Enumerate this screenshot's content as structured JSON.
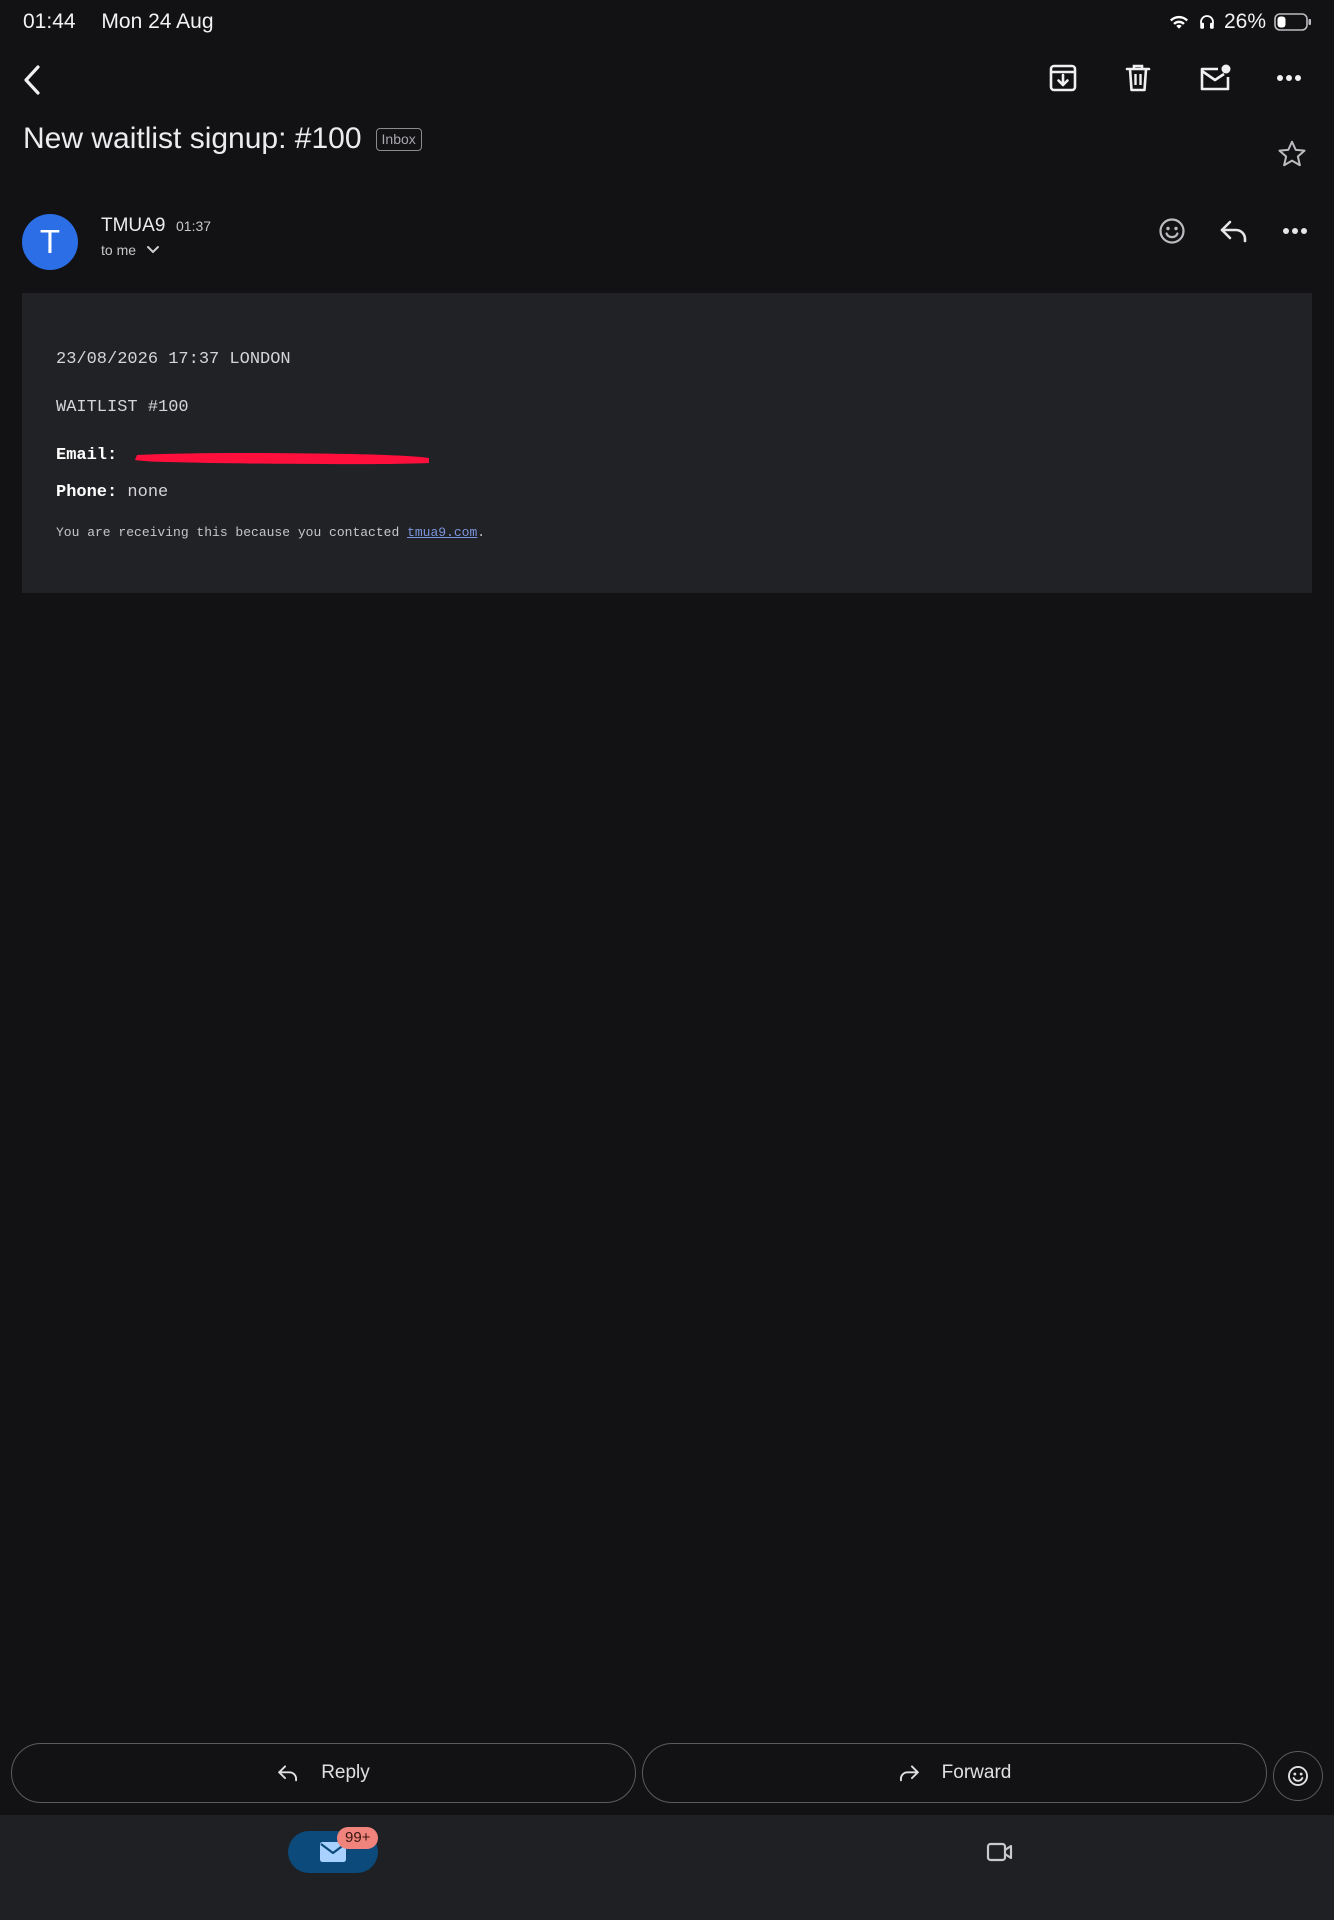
{
  "status_bar": {
    "time": "01:44",
    "date": "Mon 24 Aug",
    "battery": "26%"
  },
  "toolbar": {
    "icons": [
      "back-icon",
      "archive-icon",
      "delete-icon",
      "mark-unread-icon",
      "more-icon"
    ]
  },
  "email": {
    "subject": "New waitlist signup: #100",
    "label": "Inbox",
    "sender_initial": "T",
    "sender": "TMUA9",
    "time": "01:37",
    "recipient": "to me",
    "body": {
      "timestamp_line": "23/08/2026 17:37 LONDON",
      "waitlist_line": "WAITLIST #100",
      "email_label": "Email:",
      "phone_label": "Phone:",
      "phone_value": "none",
      "footer_prefix": "You are receiving this because you contacted ",
      "footer_link": "tmua9.com",
      "footer_suffix": "."
    }
  },
  "actions": {
    "reply": "Reply",
    "forward": "Forward"
  },
  "bottom_nav": {
    "mail_count": "99+"
  },
  "colors": {
    "background": "#121214",
    "card": "#212226",
    "avatar": "#2b6ee6",
    "link": "#7c95dd",
    "badge": "#f0847c",
    "redaction": "#ff0f3c"
  }
}
